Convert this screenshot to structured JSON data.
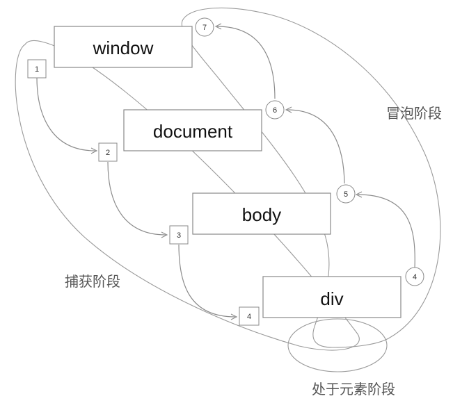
{
  "nodes": {
    "window": "window",
    "document": "document",
    "body": "body",
    "div": "div"
  },
  "capture_steps": [
    "1",
    "2",
    "3",
    "4"
  ],
  "bubble_steps": [
    "4",
    "5",
    "6",
    "7"
  ],
  "phases": {
    "capture": "捕获阶段",
    "bubble": "冒泡阶段",
    "target": "处于元素阶段"
  }
}
